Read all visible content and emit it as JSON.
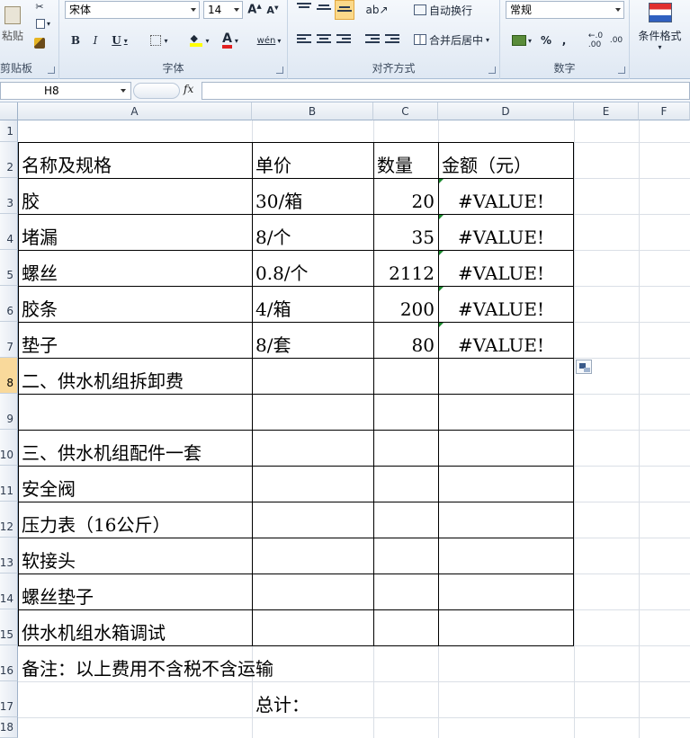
{
  "ribbon": {
    "clipboard": {
      "paste_label": "粘贴",
      "group_label": "剪贴板"
    },
    "font": {
      "font_name": "宋体",
      "font_size": "14",
      "bold": "B",
      "italic": "I",
      "underline": "U",
      "pinyin": "wén",
      "group_label": "字体"
    },
    "alignment": {
      "wrap_text": "自动换行",
      "merge_center": "合并后居中",
      "group_label": "对齐方式"
    },
    "number": {
      "format": "常规",
      "percent": "%",
      "comma": ",",
      "inc_decimal": ".00→.0",
      "dec_decimal": ".00",
      "group_label": "数字"
    },
    "styles": {
      "conditional_format": "条件格式"
    }
  },
  "formula_bar": {
    "name_box": "H8",
    "fx": "fx",
    "formula": ""
  },
  "columns": [
    "A",
    "B",
    "C",
    "D",
    "E",
    "F"
  ],
  "rows": [
    "1",
    "2",
    "3",
    "4",
    "5",
    "6",
    "7",
    "8",
    "9",
    "10",
    "11",
    "12",
    "13",
    "14",
    "15",
    "16",
    "17",
    "18"
  ],
  "selected": {
    "col": "H",
    "row": "8"
  },
  "sheet": {
    "header": {
      "name": "名称及规格",
      "unit_price": "单价",
      "qty": "数量",
      "amount": "金额（元）"
    },
    "items": [
      {
        "name": "胶",
        "unit_price": "30/箱",
        "qty": "20",
        "amount": "#VALUE!"
      },
      {
        "name": "堵漏",
        "unit_price": "8/个",
        "qty": "35",
        "amount": "#VALUE!"
      },
      {
        "name": "螺丝",
        "unit_price": "0.8/个",
        "qty": "2112",
        "amount": "#VALUE!"
      },
      {
        "name": "胶条",
        "unit_price": "4/箱",
        "qty": "200",
        "amount": "#VALUE!"
      },
      {
        "name": "垫子",
        "unit_price": "8/套",
        "qty": "80",
        "amount": "#VALUE!"
      }
    ],
    "row8": "二、供水机组拆卸费",
    "row10": "三、供水机组配件一套",
    "row11": "安全阀",
    "row12": "压力表（16公斤）",
    "row13": "软接头",
    "row14": "螺丝垫子",
    "row15": "供水机组水箱调试",
    "row16": "备注：以上费用不含税不含运输",
    "row17_b": "总计："
  }
}
